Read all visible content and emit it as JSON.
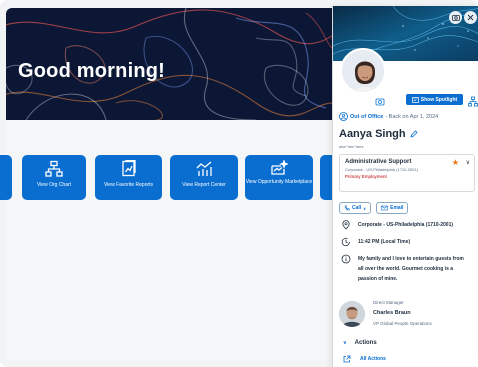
{
  "home": {
    "greeting": "Good morning!",
    "tiles": [
      {
        "label": "",
        "icon": "partial-tile"
      },
      {
        "label": "View Org Chart",
        "icon": "org-chart-icon"
      },
      {
        "label": "View Favorite Reports",
        "icon": "reports-icon"
      },
      {
        "label": "View Report Center",
        "icon": "report-center-icon"
      },
      {
        "label": "View Opportunity Marketplace",
        "icon": "marketplace-icon"
      },
      {
        "label": "",
        "icon": "partial-tile"
      }
    ]
  },
  "panel": {
    "header_icons": [
      "camera-icon",
      "close-icon"
    ],
    "spotlight_label": "Show Spotlight",
    "status": {
      "title": "Out of Office",
      "detail": "- Back on Apr 1, 2024"
    },
    "name": "Aanya Singh",
    "pronouns": "she/ her/ hers",
    "job": {
      "title": "Administrative Support",
      "department": "Corporate - US-Philadelphia (1710-2001)",
      "type": "Primary Employment"
    },
    "contact": {
      "call_label": "Call",
      "email_label": "Email"
    },
    "details": {
      "location": "Corporate - US-Philadelphia (1710-2001)",
      "local_time": "11:42 PM (Local Time)",
      "about": "My family and I love to entertain guests from all over the world. Gourmet cooking is a passion of mine."
    },
    "manager": {
      "role": "Direct Manager",
      "name": "Charles Braun",
      "title": "VP Global People Operations"
    },
    "actions": {
      "header": "Actions",
      "all_label": "All Actions"
    }
  },
  "colors": {
    "brand_blue": "#0a6ed1",
    "hero_bg": "#0c1736",
    "status_red": "#bb0000",
    "star_orange": "#e9730c"
  }
}
